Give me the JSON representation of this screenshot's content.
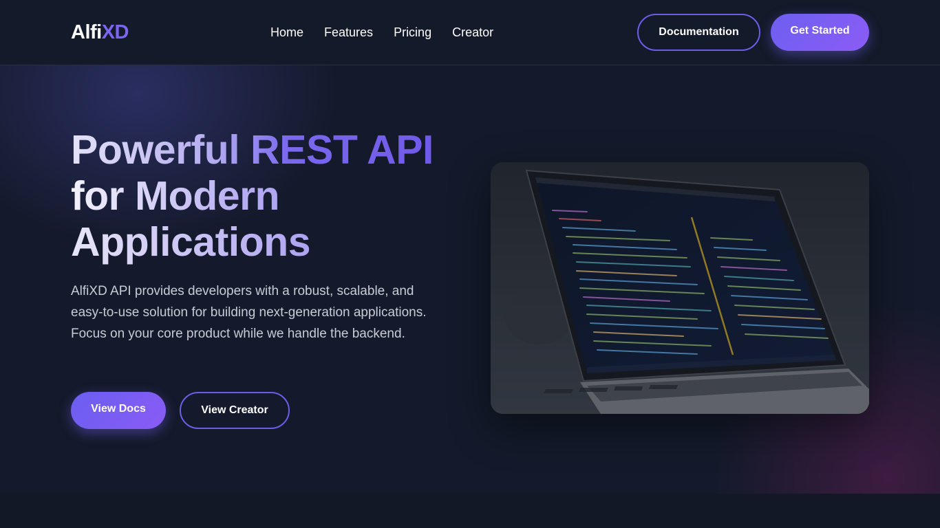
{
  "brand": {
    "logo_part1": "Alfi",
    "logo_part2": "XD"
  },
  "nav": {
    "links": [
      "Home",
      "Features",
      "Pricing",
      "Creator"
    ],
    "documentation_label": "Documentation",
    "get_started_label": "Get Started"
  },
  "hero": {
    "title_line1_a": "Powerful ",
    "title_line1_b": "REST API",
    "title_line2": "for Modern",
    "title_line3": "Applications",
    "description": "AlfiXD API provides developers with a robust, scalable, and easy-to-use solution for building next-generation applications. Focus on your core product while we handle the backend.",
    "view_docs_label": "View Docs",
    "view_creator_label": "View Creator"
  },
  "colors": {
    "accent": "#6d5ee8",
    "background": "#131a29"
  }
}
